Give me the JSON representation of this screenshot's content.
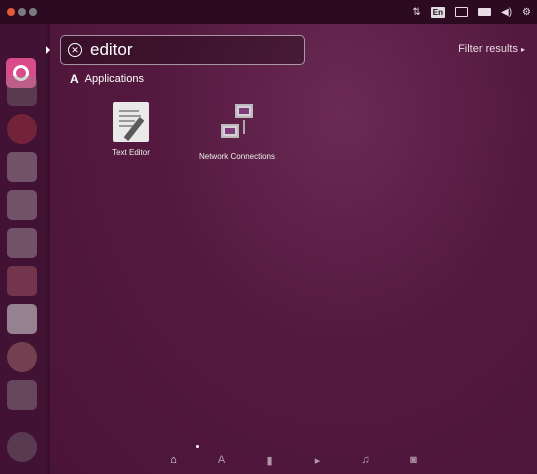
{
  "search": {
    "query": "editor"
  },
  "header": {
    "filter_label": "Filter results"
  },
  "category": {
    "name": "Applications"
  },
  "results": [
    {
      "label": "Text Editor",
      "icon": "text-editor-icon"
    },
    {
      "label": "Network Connections",
      "icon": "network-connections-icon"
    }
  ],
  "indicators": {
    "keyboard_layout": "En"
  },
  "lenses": [
    {
      "name": "home-lens",
      "glyph": "⌂",
      "active": true
    },
    {
      "name": "applications-lens",
      "glyph": "A"
    },
    {
      "name": "files-lens",
      "glyph": "▮"
    },
    {
      "name": "video-lens",
      "glyph": "▸"
    },
    {
      "name": "music-lens",
      "glyph": "♫"
    },
    {
      "name": "photos-lens",
      "glyph": "◙"
    }
  ],
  "colors": {
    "accent": "#d94c8a",
    "panel": "#2c0a22",
    "dash": "#55193f",
    "close_button": "#e65a3a"
  }
}
